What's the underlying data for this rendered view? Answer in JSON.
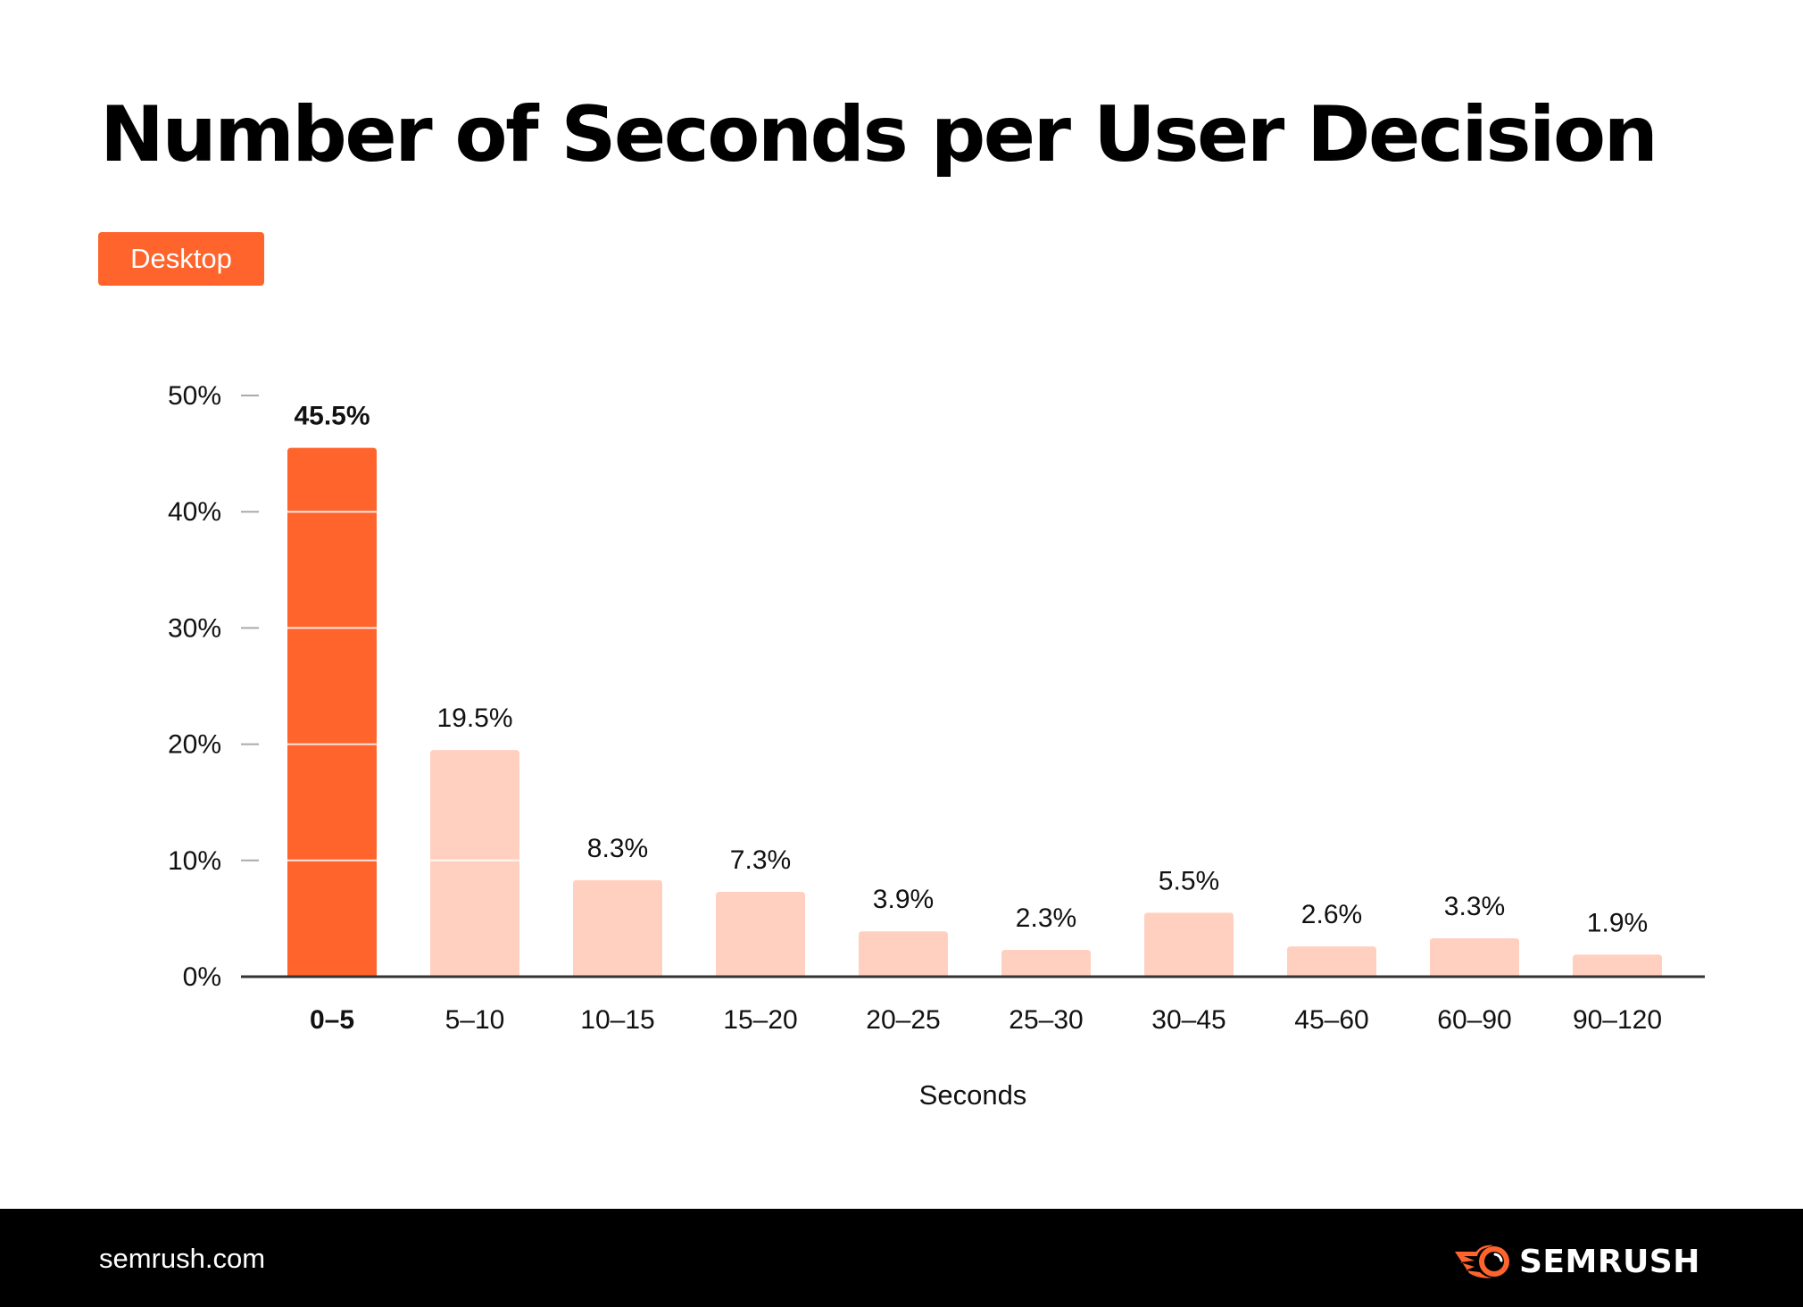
{
  "header": {
    "title": "Number of Seconds per User Decision",
    "badge_label": "Desktop"
  },
  "colors": {
    "highlight": "#FF642D",
    "bar": "#FFD0C0",
    "axis": "#333333",
    "tick": "#AAAAAA",
    "footer_bg": "#000000",
    "logo_accent": "#FF642D"
  },
  "chart_data": {
    "type": "bar",
    "title": "Number of Seconds per User Decision",
    "legend": [
      "Desktop"
    ],
    "legend_position": "top-left",
    "xlabel": "Seconds",
    "ylabel": "",
    "ylim": [
      0,
      50
    ],
    "yticks": [
      0,
      10,
      20,
      30,
      40,
      50
    ],
    "ytick_labels": [
      "0%",
      "10%",
      "20%",
      "30%",
      "40%",
      "50%"
    ],
    "grid": false,
    "categories": [
      "0–5",
      "5–10",
      "10–15",
      "15–20",
      "20–25",
      "25–30",
      "30–45",
      "45–60",
      "60–90",
      "90–120"
    ],
    "values": [
      45.5,
      19.5,
      8.3,
      7.3,
      3.9,
      2.3,
      5.5,
      2.6,
      3.3,
      1.9
    ],
    "value_labels": [
      "45.5%",
      "19.5%",
      "8.3%",
      "7.3%",
      "3.9%",
      "2.3%",
      "5.5%",
      "2.6%",
      "3.3%",
      "1.9%"
    ],
    "highlighted_category": "0–5"
  },
  "footer": {
    "site": "semrush.com",
    "logo_text": "SEMRUSH",
    "logo_icon": "semrush-fireball-icon"
  }
}
